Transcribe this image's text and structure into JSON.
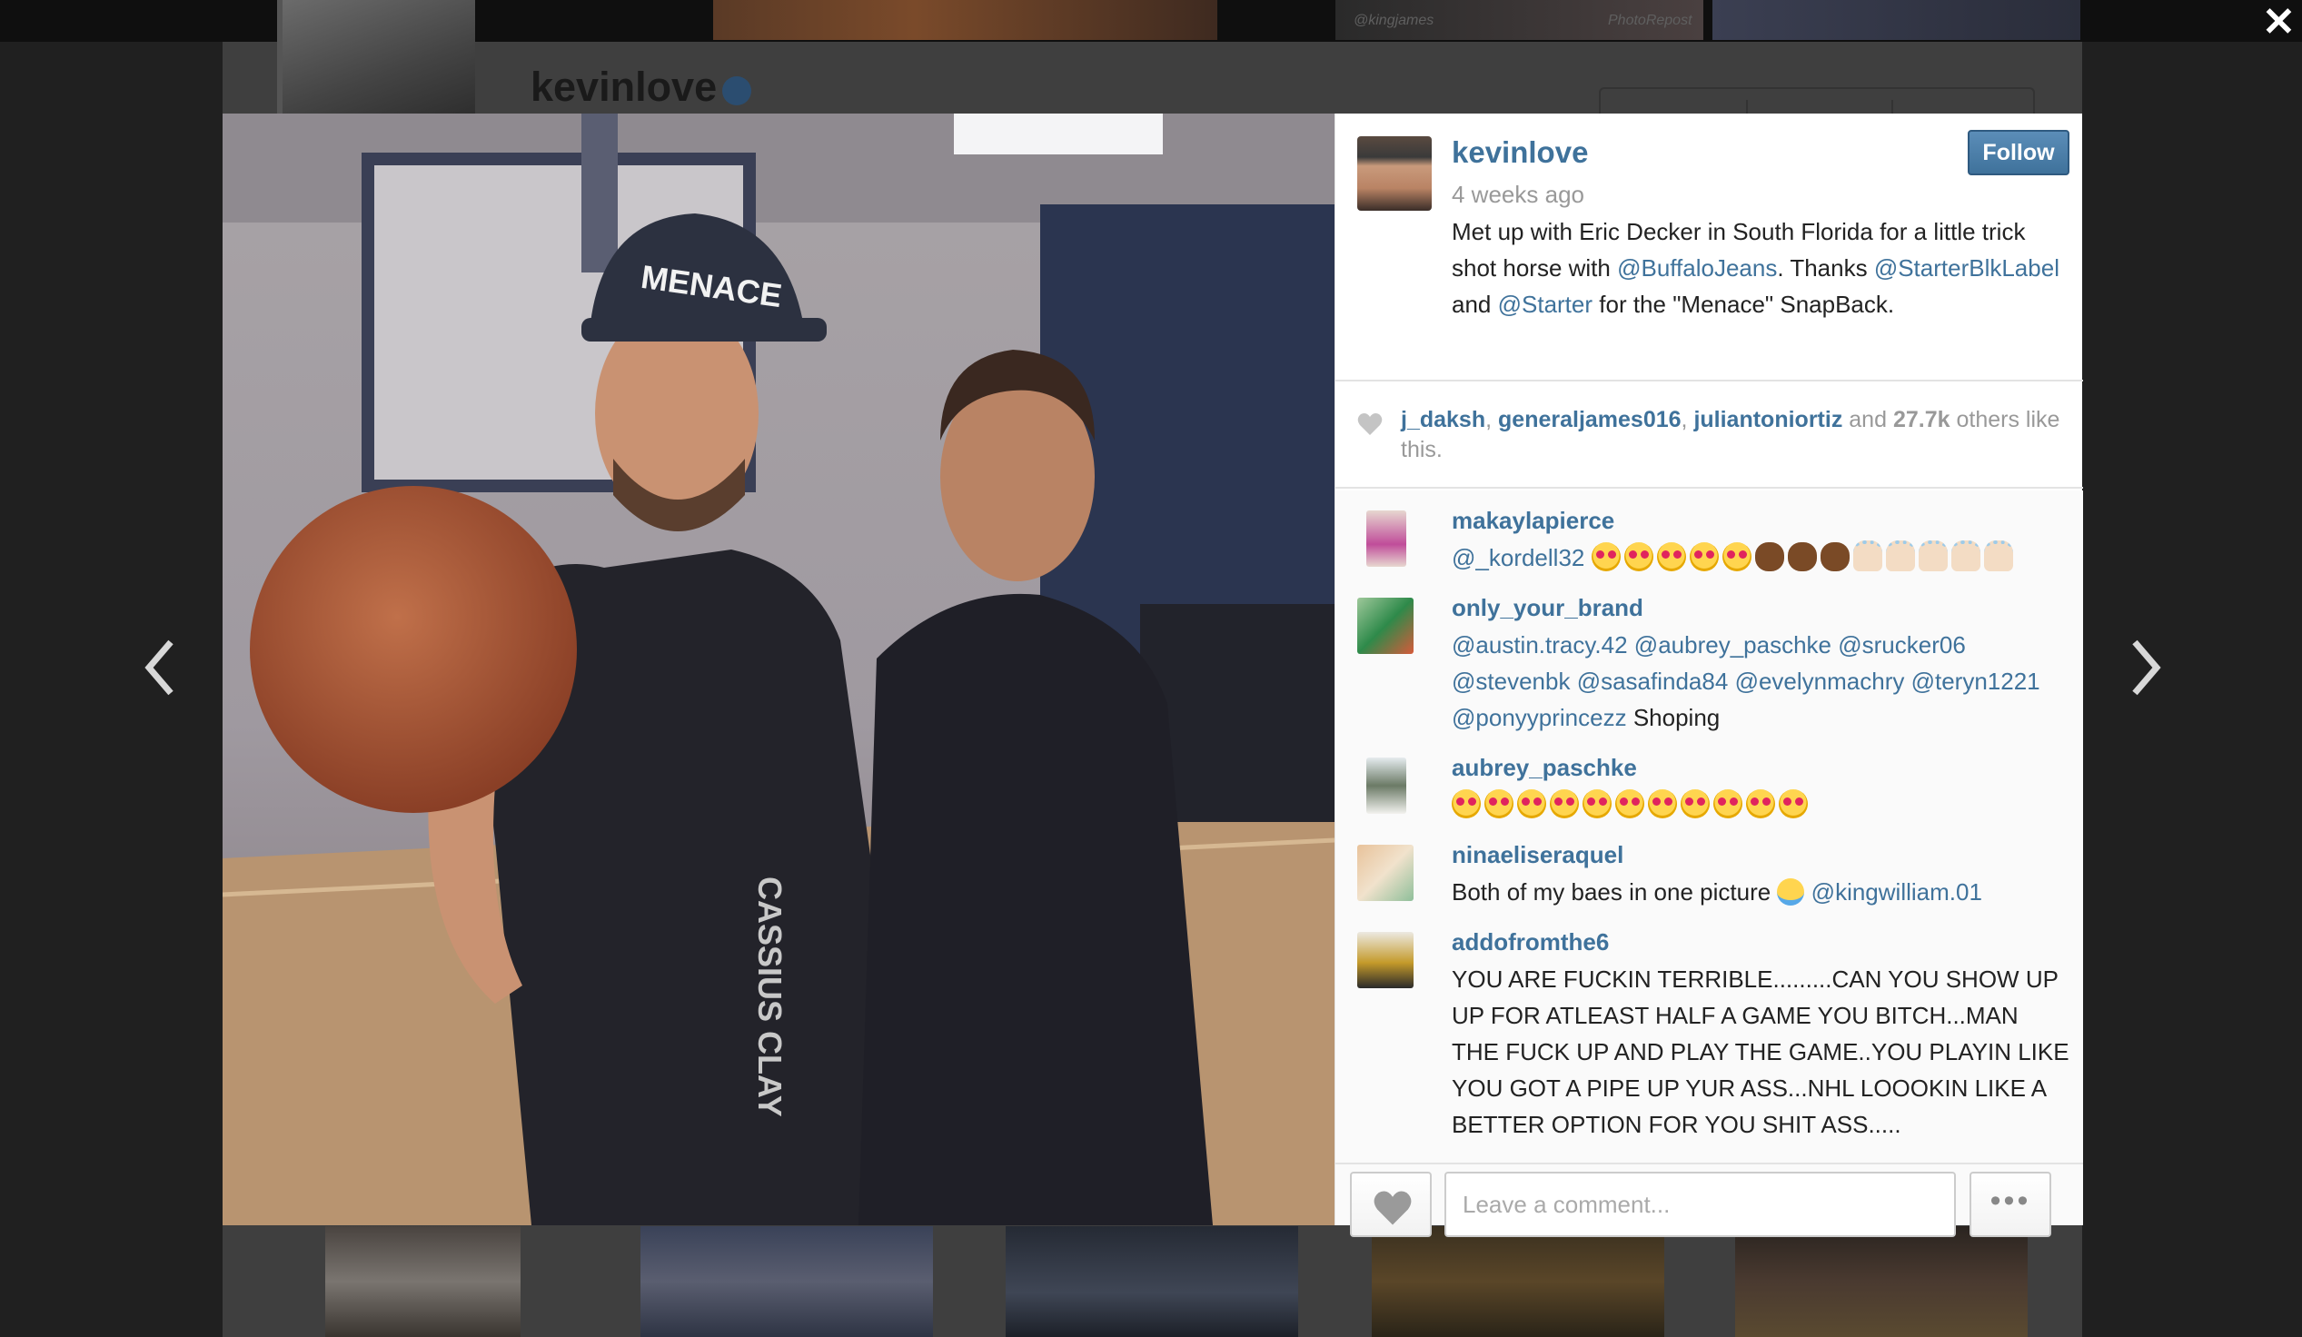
{
  "background": {
    "username": "kevinlove",
    "watermarks": [
      "@kingjames",
      "PhotoRepost"
    ]
  },
  "post": {
    "author": "kevinlove",
    "time": "4 weeks ago",
    "follow_label": "Follow",
    "caption": {
      "part1": "Met up with Eric Decker in South Florida for a little trick shot horse with ",
      "mention1": "@BuffaloJeans",
      "part2": ". Thanks ",
      "mention2": "@StarterBlkLabel",
      "part3": " and ",
      "mention3": "@Starter",
      "part4": " for the \"Menace\" SnapBack."
    },
    "photo_cap_text": "MENACE",
    "shirt_text": "CASSIUS CLAY"
  },
  "likes": {
    "users": [
      "j_daksh",
      "generaljames016",
      "juliantoniortiz"
    ],
    "and": "and",
    "count": "27.7k",
    "suffix": "others like this."
  },
  "comments": [
    {
      "user": "makaylapierce",
      "mention": "@_kordell32"
    },
    {
      "user": "only_your_brand",
      "mentions": [
        "@austin.tracy.42",
        "@aubrey_paschke",
        "@srucker06",
        "@stevenbk",
        "@sasafinda84",
        "@evelynmachry",
        "@teryn1221",
        "@ponyyprincezz"
      ],
      "text": "Shoping"
    },
    {
      "user": "aubrey_paschke"
    },
    {
      "user": "ninaeliseraquel",
      "text": "Both of my baes in one picture",
      "mention": "@kingwilliam.01"
    },
    {
      "user": "addofromthe6",
      "text": "YOU ARE FUCKIN TERRIBLE.........CAN YOU SHOW UP UP FOR ATLEAST HALF A GAME YOU BITCH...MAN THE FUCK UP AND PLAY THE GAME..YOU PLAYIN LIKE YOU GOT A PIPE UP YUR ASS...NHL LOOOKIN LIKE A BETTER OPTION FOR YOU SHIT ASS....."
    }
  ],
  "footer": {
    "comment_placeholder": "Leave a comment...",
    "more_label": "•••"
  },
  "icons": {
    "close": "close-icon",
    "prev": "chevron-left-icon",
    "next": "chevron-right-icon",
    "like": "heart-icon"
  },
  "colors": {
    "link": "#3f729b",
    "follow_button": "#3f729b",
    "muted_text": "#999999"
  }
}
